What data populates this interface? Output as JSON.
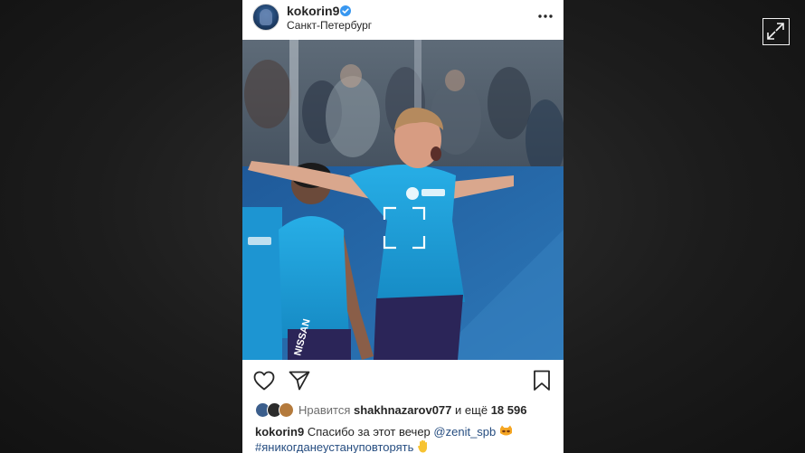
{
  "post": {
    "username": "kokorin9",
    "location": "Санкт-Петербург",
    "likes": {
      "prefix": "Нравится",
      "user": "shakhnazarov077",
      "conj": "и ещё",
      "count": "18 596"
    },
    "caption": {
      "username": "kokorin9",
      "text": "Спасибо за этот вечер",
      "mention": "@zenit_spb",
      "hashtag": "#яникогданеустануповторять"
    },
    "photo": {
      "kit_sponsor": "NISSAN"
    }
  },
  "icons": {
    "verified": "verified-badge-icon",
    "more": "more-options-icon",
    "like": "heart-icon",
    "share": "direct-share-icon",
    "save": "bookmark-icon",
    "expand": "expand-icon",
    "focus": "focus-frame-icon"
  },
  "colors": {
    "verified_blue": "#3897f0",
    "kit_blue": "#1a9ad6",
    "shorts_navy": "#2b2558",
    "link_blue": "#264d80"
  }
}
